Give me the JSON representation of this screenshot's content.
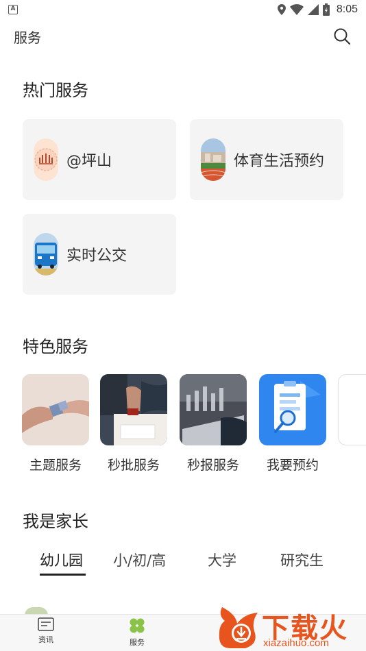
{
  "status_bar": {
    "time": "8:05",
    "notification_badge": "A"
  },
  "app_bar": {
    "title": "服务"
  },
  "hot_services": {
    "title": "热门服务",
    "items": [
      {
        "label": "@坪山",
        "icon": "pingshan-logo-icon"
      },
      {
        "label": "体育生活预约",
        "icon": "sports-field-icon"
      },
      {
        "label": "实时公交",
        "icon": "bus-icon"
      }
    ]
  },
  "featured_services": {
    "title": "特色服务",
    "items": [
      {
        "label": "主题服务"
      },
      {
        "label": "秒批服务"
      },
      {
        "label": "秒报服务"
      },
      {
        "label": "我要预约"
      },
      {
        "label": ""
      }
    ]
  },
  "parent_section": {
    "title": "我是家长",
    "tabs": [
      {
        "label": "幼儿园",
        "active": true
      },
      {
        "label": "小/初/高",
        "active": false
      },
      {
        "label": "大学",
        "active": false
      },
      {
        "label": "研究生",
        "active": false
      }
    ]
  },
  "bottom_nav": {
    "items": [
      {
        "label": "资讯",
        "icon": "news-icon"
      },
      {
        "label": "服务",
        "icon": "clover-icon",
        "active": true
      }
    ]
  },
  "watermark": {
    "text": "下载火",
    "url": "xiazaihuo.com"
  },
  "colors": {
    "accent_green": "#8bc34a",
    "watermark_orange": "#e8541e",
    "card_bg": "#f4f4f4"
  }
}
